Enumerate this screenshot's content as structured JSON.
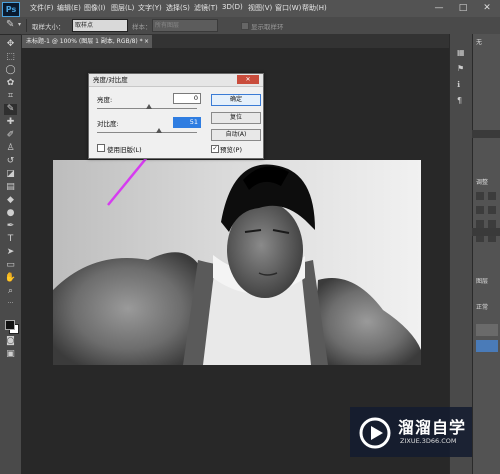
{
  "app": {
    "logo": "Ps"
  },
  "menu": [
    "文件(F)",
    "编辑(E)",
    "图像(I)",
    "图层(L)",
    "文字(Y)",
    "选择(S)",
    "滤镜(T)",
    "3D(D)",
    "视图(V)",
    "窗口(W)",
    "帮助(H)"
  ],
  "window_controls": {
    "minimize": "—",
    "maximize": "□",
    "close": "✕"
  },
  "options": {
    "brush_size_label": "取样大小：",
    "brush_size_value": "取样点",
    "sample_label": "样本：",
    "sample_value": "所有图层",
    "show_ring_label": "显示取样环"
  },
  "document": {
    "tab_title": "未标题-1 @ 100% (图层 1 副本, RGB/8) *",
    "tab_close": "×"
  },
  "right_panel": {
    "header_text": "无",
    "layers_label": "调整",
    "paths_label": "图层",
    "normal_label": "正常"
  },
  "dialog": {
    "title": "亮度/对比度",
    "close": "✕",
    "brightness_label": "亮度:",
    "brightness_value": "0",
    "contrast_label": "对比度:",
    "contrast_value": "51",
    "ok_label": "确定",
    "reset_label": "复位",
    "auto_label": "自动(A)",
    "legacy_label": "使用旧版(L)",
    "preview_label": "预览(P)",
    "preview_checked": true,
    "legacy_checked": false
  },
  "watermark": {
    "title": "溜溜自学",
    "url": "ZIXUE.3D66.COM"
  },
  "colors": {
    "accent": "#3a7bd5",
    "arrow": "#d63cf0",
    "ps_blue": "#4aa3df"
  }
}
